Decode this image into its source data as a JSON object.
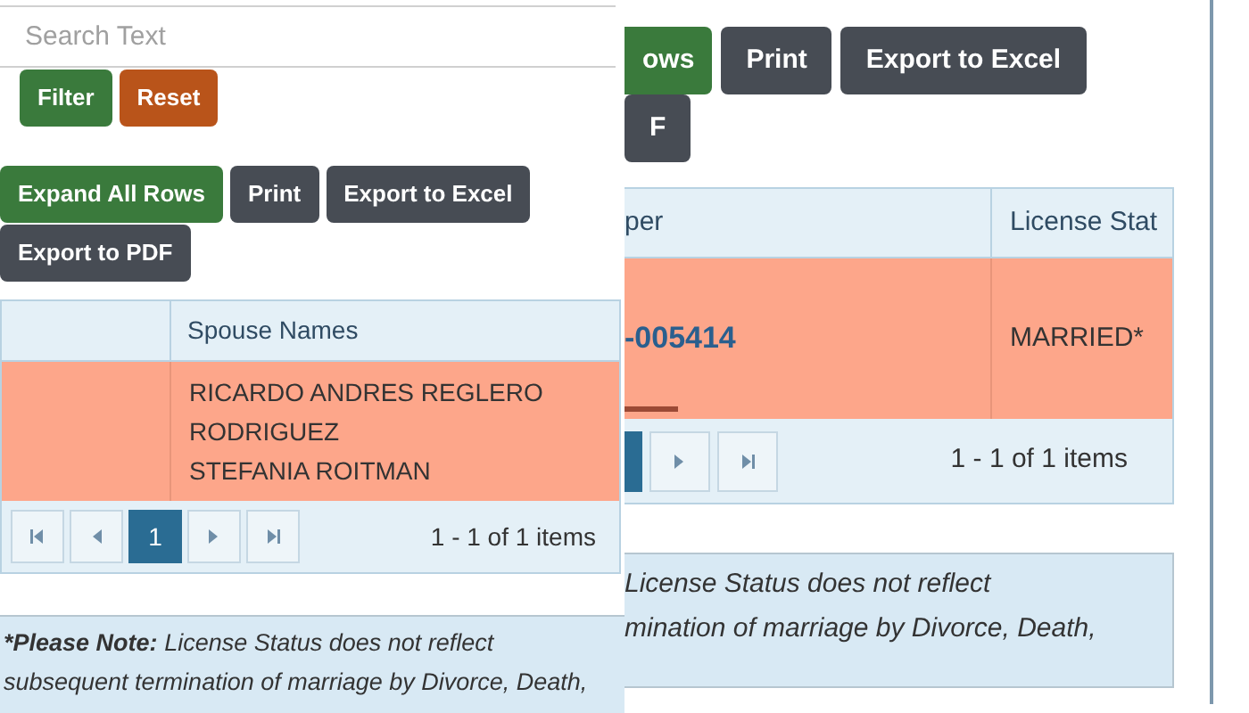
{
  "left_panel": {
    "search": {
      "placeholder": "Search Text"
    },
    "filter_buttons": [
      {
        "label": "Filter",
        "kind": "primary"
      },
      {
        "label": "Reset",
        "kind": "warning"
      }
    ],
    "toolbar_buttons": [
      {
        "label": "Expand All Rows",
        "kind": "primary"
      },
      {
        "label": "Print",
        "kind": "dark"
      },
      {
        "label": "Export to Excel",
        "kind": "dark"
      },
      {
        "label": "Export to PDF",
        "kind": "dark"
      }
    ],
    "table": {
      "columns": [
        {
          "label": "Spouse Names"
        }
      ],
      "rows": [
        {
          "spouse_names": [
            "RICARDO ANDRES REGLERO RODRIGUEZ",
            "STEFANIA ROITMAN"
          ]
        }
      ]
    },
    "pager": {
      "pages": [
        {
          "label": "1",
          "selected": true
        }
      ],
      "summary": "1 - 1 of 1 items"
    },
    "note": {
      "label": "*Please Note:",
      "lines": [
        "License Status does not reflect",
        "subsequent termination of marriage by Divorce, Death,"
      ]
    }
  },
  "right_panel": {
    "toolbar_buttons": [
      {
        "label": "ows",
        "kind": "primary"
      },
      {
        "label": "Print",
        "kind": "dark"
      },
      {
        "label": "Export to Excel",
        "kind": "dark"
      },
      {
        "label": "F",
        "kind": "dark"
      }
    ],
    "table": {
      "columns": [
        {
          "label": "per"
        },
        {
          "label": "License Stat"
        }
      ],
      "rows": [
        {
          "number": "-005414",
          "status": "MARRIED*"
        }
      ]
    },
    "pager": {
      "summary": "1 - 1 of 1 items"
    },
    "note": {
      "lines": [
        "License Status does not reflect",
        "mination of marriage by Divorce, Death,"
      ]
    }
  }
}
